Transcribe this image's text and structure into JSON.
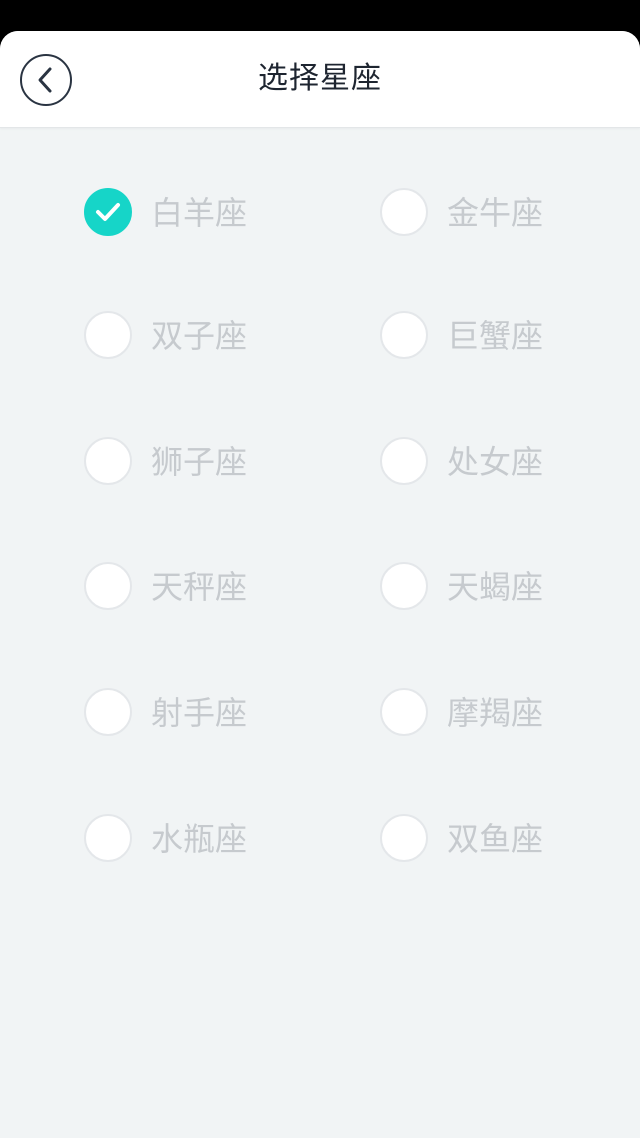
{
  "header": {
    "title": "选择星座",
    "back_icon": "chevron-left-icon"
  },
  "colors": {
    "accent": "#16d5c8",
    "label": "#c6cace",
    "background": "#f1f4f5",
    "title": "#1e2530"
  },
  "options": [
    {
      "label": "白羊座",
      "checked": true
    },
    {
      "label": "金牛座",
      "checked": false
    },
    {
      "label": "双子座",
      "checked": false
    },
    {
      "label": "巨蟹座",
      "checked": false
    },
    {
      "label": "狮子座",
      "checked": false
    },
    {
      "label": "处女座",
      "checked": false
    },
    {
      "label": "天秤座",
      "checked": false
    },
    {
      "label": "天蝎座",
      "checked": false
    },
    {
      "label": "射手座",
      "checked": false
    },
    {
      "label": "摩羯座",
      "checked": false
    },
    {
      "label": "水瓶座",
      "checked": false
    },
    {
      "label": "双鱼座",
      "checked": false
    }
  ]
}
